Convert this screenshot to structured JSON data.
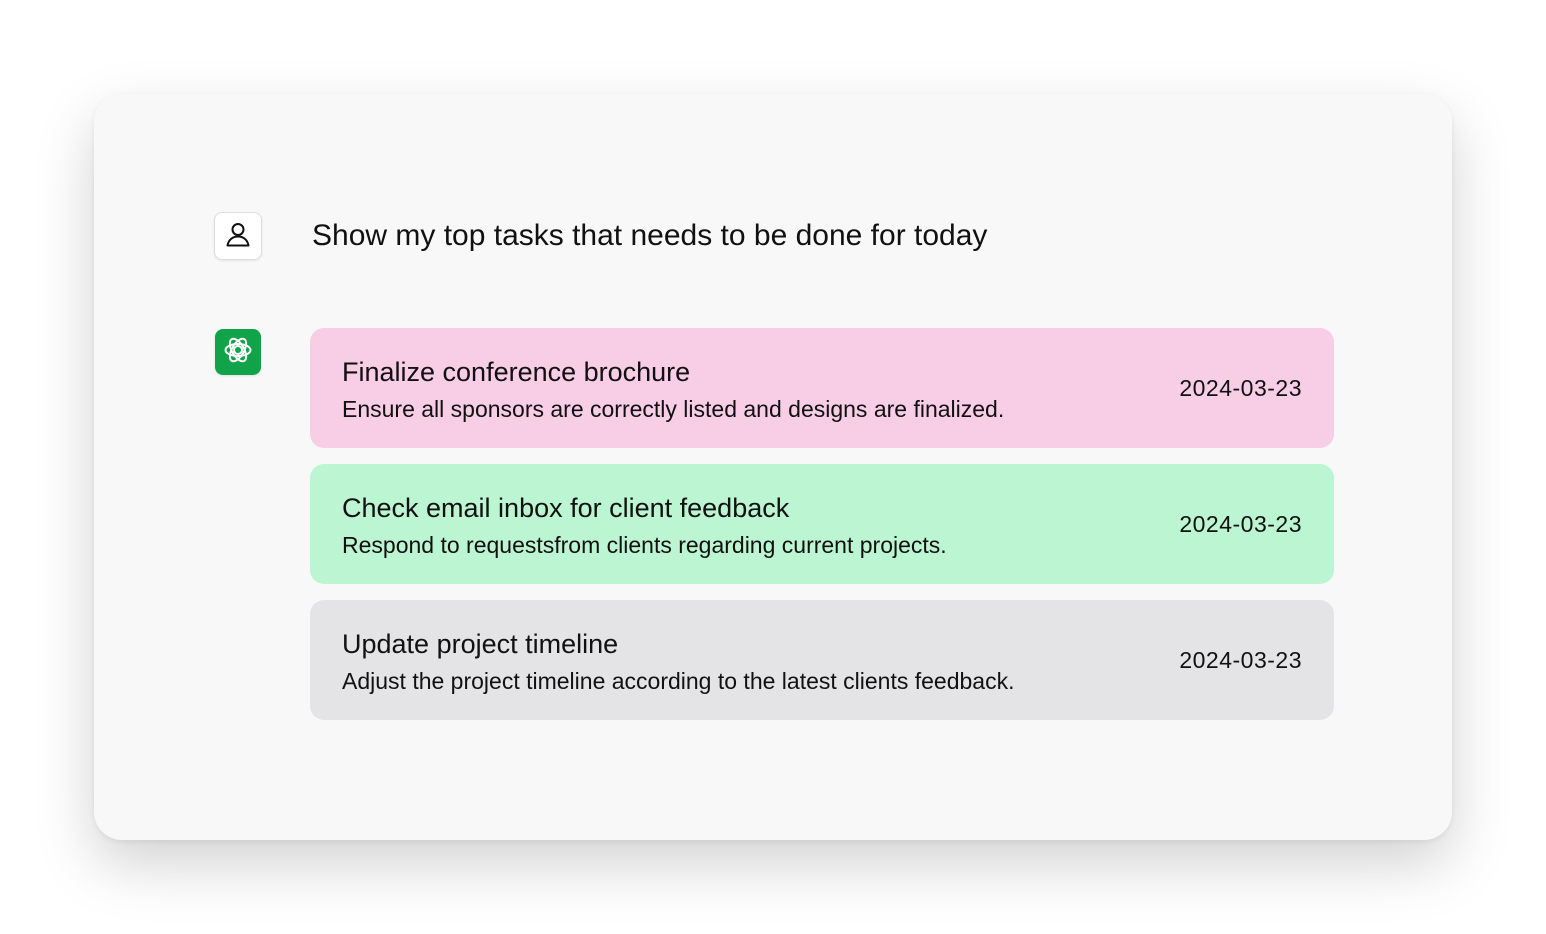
{
  "conversation": {
    "user": {
      "avatar_icon": "person-outline-icon",
      "message": "Show my top tasks that needs to be done for today"
    },
    "assistant": {
      "avatar_icon": "openai-logo-icon",
      "avatar_color": "#10a34a",
      "tasks": [
        {
          "title": "Finalize conference brochure",
          "description": "Ensure all sponsors are correctly listed and designs are finalized.",
          "date": "2024-03-23",
          "color": "#f8cde6"
        },
        {
          "title": "Check email inbox for client feedback",
          "description": "Respond to requestsfrom clients regarding current projects.",
          "date": "2024-03-23",
          "color": "#bbf5d2"
        },
        {
          "title": "Update project timeline",
          "description": "Adjust the project timeline according to the latest clients feedback.",
          "date": "2024-03-23",
          "color": "#e4e4e6"
        }
      ]
    }
  }
}
